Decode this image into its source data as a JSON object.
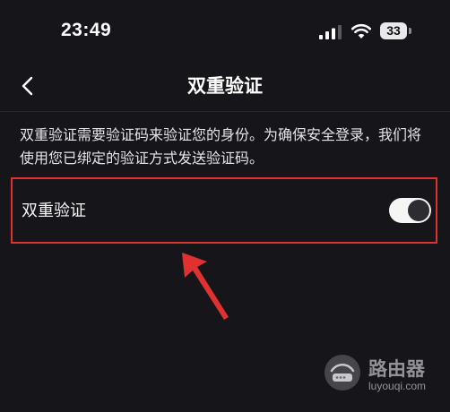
{
  "status_bar": {
    "time": "23:49",
    "battery_level": "33",
    "signal_icon": "signal-bars-icon",
    "wifi_icon": "wifi-icon"
  },
  "nav": {
    "back_icon": "chevron-left-icon",
    "title": "双重验证"
  },
  "description": "双重验证需要验证码来验证您的身份。为确保安全登录，我们将使用您已绑定的验证方式发送验证码。",
  "setting": {
    "label": "双重验证",
    "toggle_on": true
  },
  "annotation": {
    "highlight_color": "#e03131",
    "arrow_color": "#e03131"
  },
  "watermark": {
    "text": "路由器",
    "url": "luyouqi.com"
  }
}
